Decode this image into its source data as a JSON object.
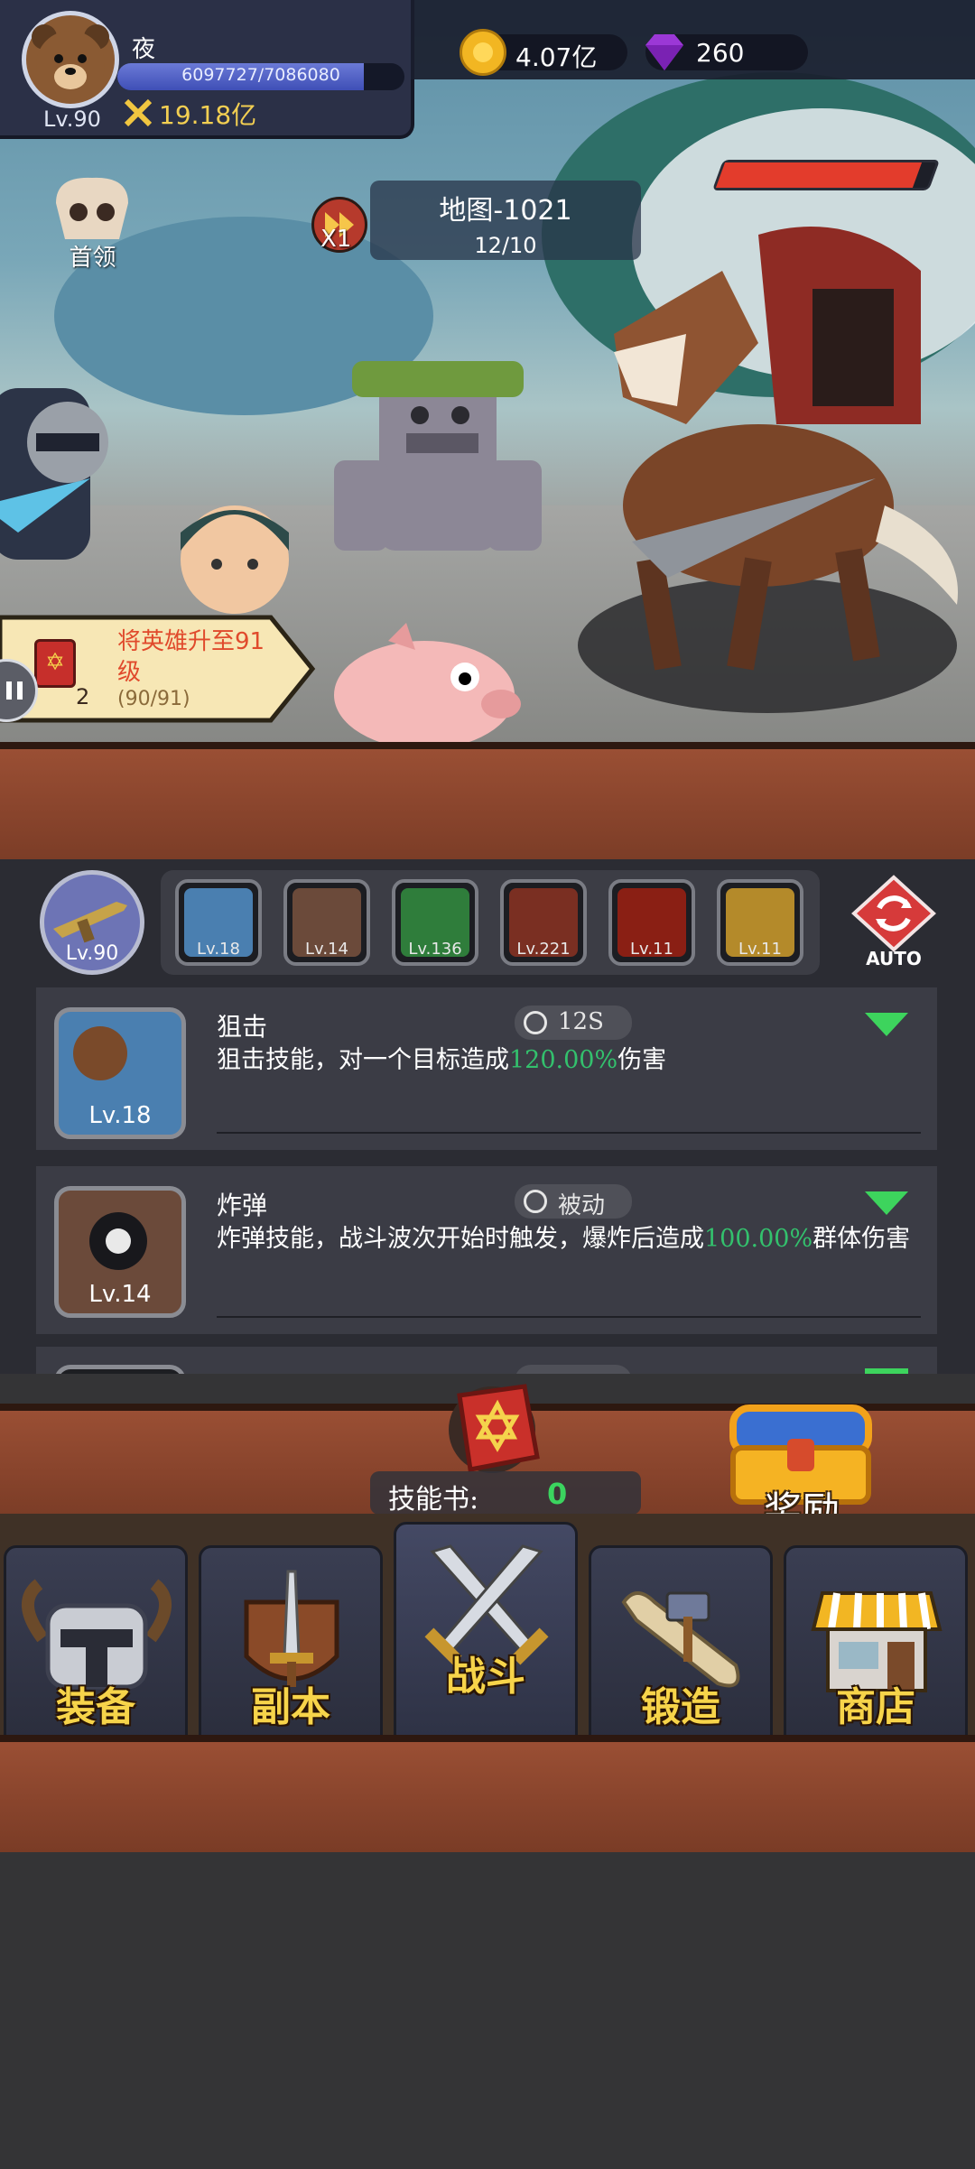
{
  "player": {
    "name": "夜",
    "level_label": "Lv.90",
    "xp_text": "6097727/7086080",
    "xp_fraction": 0.86,
    "power": "19.18亿"
  },
  "currency": {
    "gold": "4.07亿",
    "gems": "260"
  },
  "battle": {
    "map_title": "地图-1021",
    "wave": "12/10",
    "speed": "X1",
    "boss_label": "首领",
    "enemy_hp_fraction": 0.93
  },
  "quest": {
    "text": "将英雄升至91级",
    "progress": "(90/91)",
    "count": "2"
  },
  "skills_bar": {
    "hero_level": "Lv.90",
    "auto_label": "AUTO",
    "slots": [
      {
        "icon": "sniper-skill-icon",
        "level": "Lv.18",
        "color": "#4a7fb0"
      },
      {
        "icon": "bomb-skill-icon",
        "level": "Lv.14",
        "color": "#6b4a3a"
      },
      {
        "icon": "poison-skill-icon",
        "level": "Lv.136",
        "color": "#2f7d3b"
      },
      {
        "icon": "meteor-skill-icon",
        "level": "Lv.221",
        "color": "#7a2f22"
      },
      {
        "icon": "fire-skill-icon",
        "level": "Lv.11",
        "color": "#8a1f14"
      },
      {
        "icon": "lightning-skill-icon",
        "level": "Lv.11",
        "color": "#b48a2a"
      }
    ]
  },
  "skill_cards": [
    {
      "name": "狙击",
      "timer": "12S",
      "level": "Lv.18",
      "desc_pre": "狙击技能，对一个目标造成",
      "desc_pct": "120.00%",
      "desc_post": "伤害"
    },
    {
      "name": "炸弹",
      "timer": "被动",
      "level": "Lv.14",
      "desc_pre": "炸弹技能，战斗波次开始时触发，爆炸后造成",
      "desc_pct": "100.00%",
      "desc_post": "群体伤害"
    }
  ],
  "skill_book": {
    "label": "技能书:",
    "count": "0"
  },
  "reward": {
    "label": "奖励"
  },
  "nav": [
    {
      "label": "装备",
      "icon": "helmet-icon"
    },
    {
      "label": "副本",
      "icon": "sword-shield-icon"
    },
    {
      "label": "战斗",
      "icon": "crossed-swords-icon"
    },
    {
      "label": "锻造",
      "icon": "scroll-hammer-icon"
    },
    {
      "label": "商店",
      "icon": "shop-icon"
    }
  ]
}
